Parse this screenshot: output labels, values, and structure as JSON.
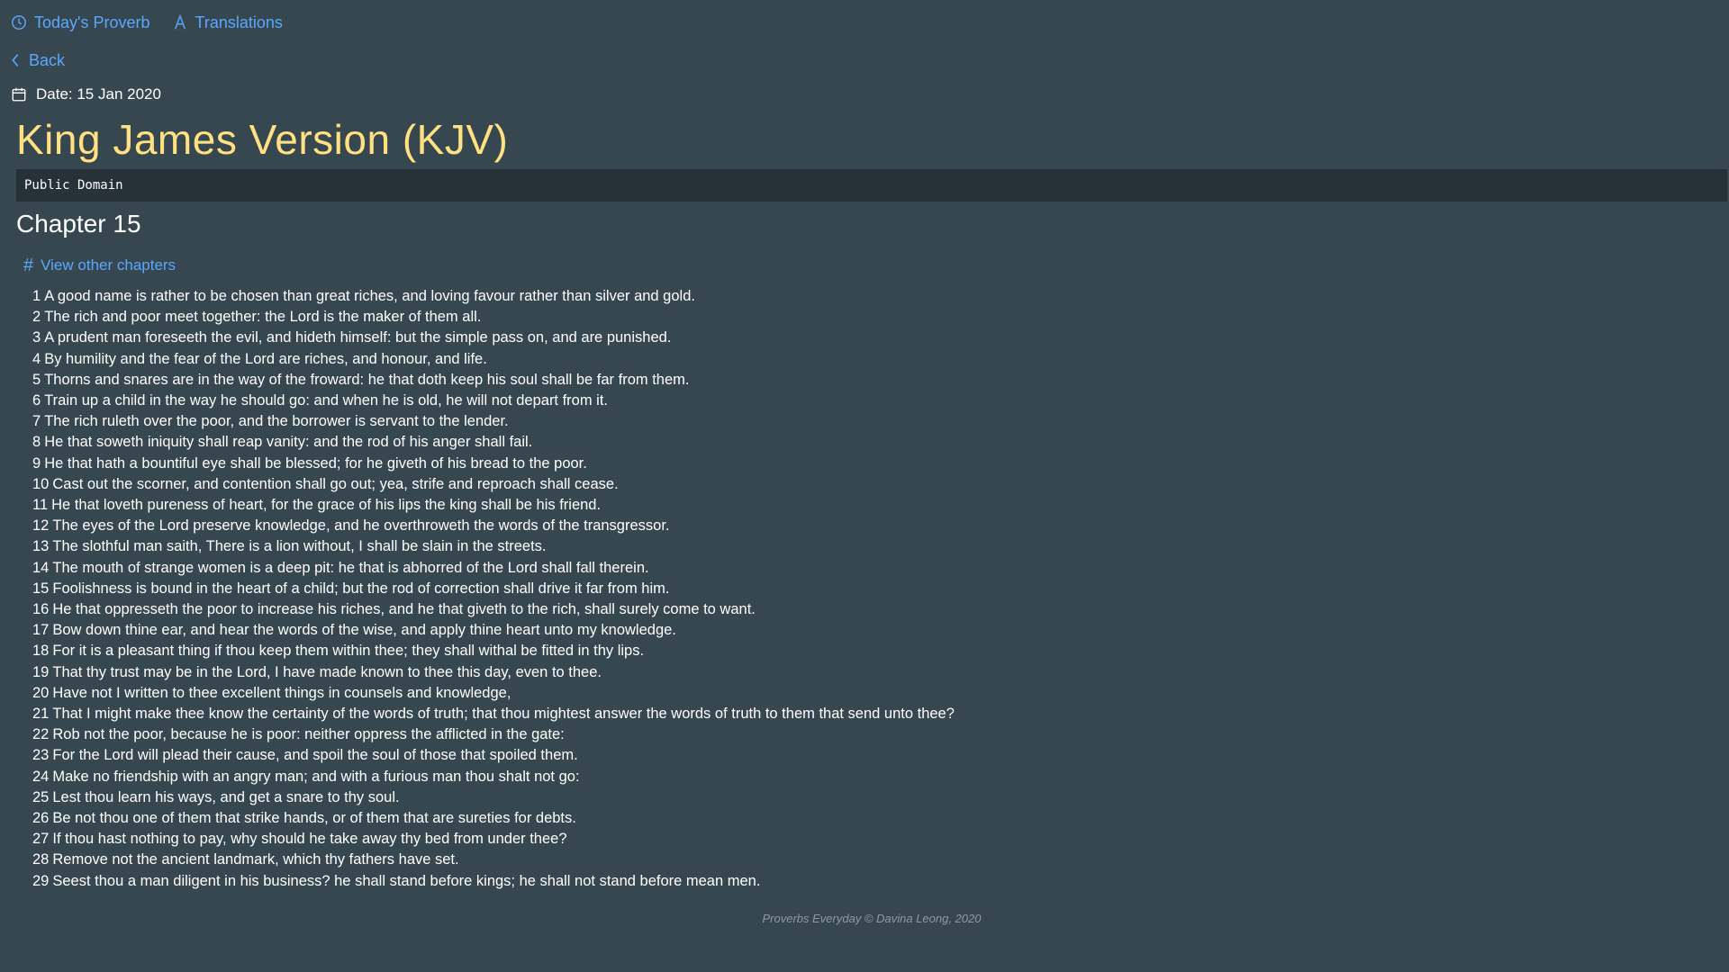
{
  "nav": {
    "todays_proverb": "Today's Proverb",
    "translations": "Translations",
    "back": "Back"
  },
  "date": {
    "text": "Date: 15 Jan 2020"
  },
  "translation": {
    "title": "King James Version (KJV)",
    "license": "Public Domain"
  },
  "chapter": {
    "title": "Chapter 15",
    "view_other": "View other chapters"
  },
  "verses": [
    {
      "num": "1",
      "text": "A good name is rather to be chosen than great riches, and loving favour rather than silver and gold."
    },
    {
      "num": "2",
      "text": "The rich and poor meet together: the Lord is the maker of them all."
    },
    {
      "num": "3",
      "text": "A prudent man foreseeth the evil, and hideth himself: but the simple pass on, and are punished."
    },
    {
      "num": "4",
      "text": "By humility and the fear of the Lord are riches, and honour, and life."
    },
    {
      "num": "5",
      "text": "Thorns and snares are in the way of the froward: he that doth keep his soul shall be far from them."
    },
    {
      "num": "6",
      "text": "Train up a child in the way he should go: and when he is old, he will not depart from it."
    },
    {
      "num": "7",
      "text": "The rich ruleth over the poor, and the borrower is servant to the lender."
    },
    {
      "num": "8",
      "text": "He that soweth iniquity shall reap vanity: and the rod of his anger shall fail."
    },
    {
      "num": "9",
      "text": "He that hath a bountiful eye shall be blessed; for he giveth of his bread to the poor."
    },
    {
      "num": "10",
      "text": "Cast out the scorner, and contention shall go out; yea, strife and reproach shall cease."
    },
    {
      "num": "11",
      "text": "He that loveth pureness of heart, for the grace of his lips the king shall be his friend."
    },
    {
      "num": "12",
      "text": "The eyes of the Lord preserve knowledge, and he overthroweth the words of the transgressor."
    },
    {
      "num": "13",
      "text": "The slothful man saith, There is a lion without, I shall be slain in the streets."
    },
    {
      "num": "14",
      "text": "The mouth of strange women is a deep pit: he that is abhorred of the Lord shall fall therein."
    },
    {
      "num": "15",
      "text": "Foolishness is bound in the heart of a child; but the rod of correction shall drive it far from him."
    },
    {
      "num": "16",
      "text": "He that oppresseth the poor to increase his riches, and he that giveth to the rich, shall surely come to want."
    },
    {
      "num": "17",
      "text": "Bow down thine ear, and hear the words of the wise, and apply thine heart unto my knowledge."
    },
    {
      "num": "18",
      "text": "For it is a pleasant thing if thou keep them within thee; they shall withal be fitted in thy lips."
    },
    {
      "num": "19",
      "text": "That thy trust may be in the Lord, I have made known to thee this day, even to thee."
    },
    {
      "num": "20",
      "text": "Have not I written to thee excellent things in counsels and knowledge,"
    },
    {
      "num": "21",
      "text": "That I might make thee know the certainty of the words of truth; that thou mightest answer the words of truth to them that send unto thee?"
    },
    {
      "num": "22",
      "text": "Rob not the poor, because he is poor: neither oppress the afflicted in the gate:"
    },
    {
      "num": "23",
      "text": "For the Lord will plead their cause, and spoil the soul of those that spoiled them."
    },
    {
      "num": "24",
      "text": "Make no friendship with an angry man; and with a furious man thou shalt not go:"
    },
    {
      "num": "25",
      "text": "Lest thou learn his ways, and get a snare to thy soul."
    },
    {
      "num": "26",
      "text": "Be not thou one of them that strike hands, or of them that are sureties for debts."
    },
    {
      "num": "27",
      "text": "If thou hast nothing to pay, why should he take away thy bed from under thee?"
    },
    {
      "num": "28",
      "text": "Remove not the ancient landmark, which thy fathers have set."
    },
    {
      "num": "29",
      "text": "Seest thou a man diligent in his business? he shall stand before kings; he shall not stand before mean men."
    }
  ],
  "footer": {
    "text": "Proverbs Everyday © Davina Leong, 2020"
  },
  "colors": {
    "background": "#37474f",
    "link": "#5aa7ff",
    "title": "#ffe082",
    "license_bg": "#263238"
  },
  "icons": {
    "todays_proverb": "clock-icon",
    "translations": "letter-a-icon",
    "back": "chevron-left-icon",
    "date": "calendar-icon",
    "view_other": "hash-icon"
  }
}
